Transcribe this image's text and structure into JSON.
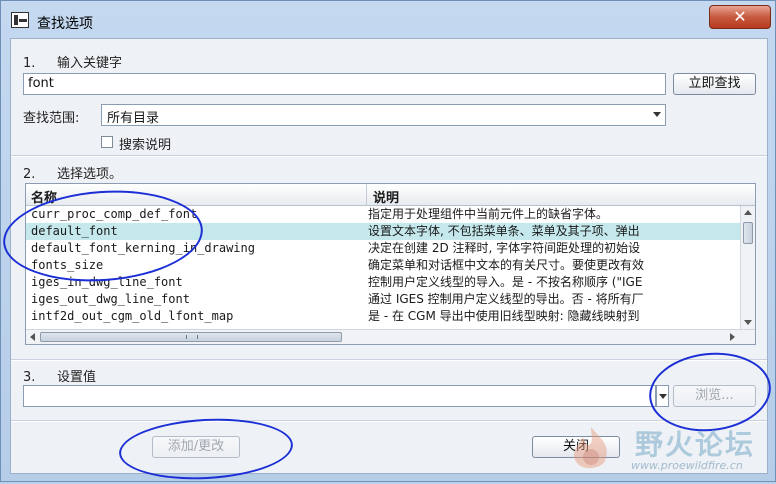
{
  "window": {
    "title": "查找选项",
    "close_glyph": "✕"
  },
  "section1": {
    "number": "1.",
    "label": "输入关键字"
  },
  "keyword": {
    "value": "font"
  },
  "search_button": {
    "label": "立即查找"
  },
  "scope": {
    "label": "查找范围:",
    "value": "所有目录"
  },
  "search_desc_checkbox": {
    "label": "搜索说明",
    "checked": false
  },
  "section2": {
    "number": "2.",
    "label": "选择选项。"
  },
  "table": {
    "columns": [
      "名称",
      "说明"
    ],
    "rows": [
      {
        "name": "curr_proc_comp_def_font",
        "desc": "指定用于处理组件中当前元件上的缺省字体。"
      },
      {
        "name": "default_font",
        "desc": "设置文本字体, 不包括菜单条、菜单及其子项、弹出"
      },
      {
        "name": "default_font_kerning_in_drawing",
        "desc": "决定在创建 2D 注释时, 字体字符间距处理的初始设"
      },
      {
        "name": "fonts_size",
        "desc": "确定菜单和对话框中文本的有关尺寸。要使更改有效"
      },
      {
        "name": "iges_in_dwg_line_font",
        "desc": "控制用户定义线型的导入。是 - 不按名称顺序 (\"IGE"
      },
      {
        "name": "iges_out_dwg_line_font",
        "desc": "通过 IGES 控制用户定义线型的导出。否 - 将所有厂"
      },
      {
        "name": "intf2d_out_cgm_old_lfont_map",
        "desc": "是 - 在 CGM 导出中使用旧线型映射: 隐藏线映射到"
      }
    ],
    "selected_index": 1
  },
  "section3": {
    "number": "3.",
    "label": "设置值"
  },
  "value_field": {
    "value": ""
  },
  "browse_button": {
    "label": "浏览..."
  },
  "add_change_button": {
    "label": "添加/更改"
  },
  "close_button": {
    "label": "关闭"
  },
  "watermark": {
    "text": "野火论坛",
    "url": "www.proewildfire.cn"
  },
  "colors": {
    "selection": "#c4e8ec",
    "annotation": "#1c2fd6",
    "close": "#c75a3f"
  }
}
